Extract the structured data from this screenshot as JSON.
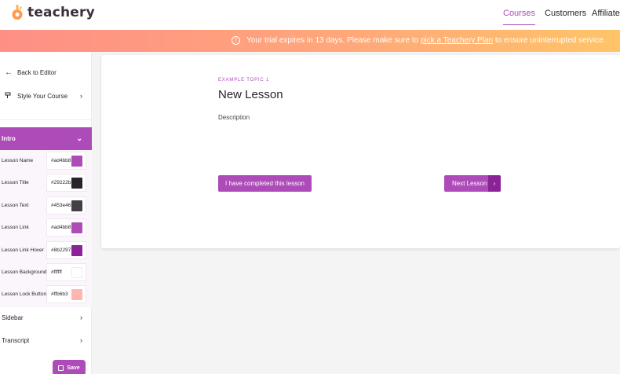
{
  "brand": {
    "name": "teachery",
    "accent": "#ad4bb8"
  },
  "nav": {
    "courses": "Courses",
    "customers": "Customers",
    "affiliates": "Affiliates"
  },
  "banner": {
    "text_before": "Your trial expires in 13 days. Please make sure to",
    "link": "pick a Teachery Plan",
    "text_after": "to ensure uninterrupted service.",
    "icon": "info-icon"
  },
  "sidebar": {
    "back_label": "Back to Editor",
    "style_label": "Style Your Course",
    "intro_label": "Intro",
    "settings": [
      {
        "label": "Lesson Name",
        "hex": "#ad4bb8",
        "color": "#ad4bb8"
      },
      {
        "label": "Lesson Title",
        "hex": "#29222b",
        "color": "#29222b"
      },
      {
        "label": "Lesson Text",
        "hex": "#453e46",
        "color": "#453e46"
      },
      {
        "label": "Lesson Link",
        "hex": "#ad4bb8",
        "color": "#ad4bb8"
      },
      {
        "label": "Lesson Link Hover",
        "hex": "#8b2297",
        "color": "#8b2297"
      },
      {
        "label": "Lesson Background",
        "hex": "#ffffff",
        "color": "#ffffff"
      },
      {
        "label": "Lesson Lock Button",
        "hex": "#ffb6b3",
        "color": "#ffb6b3"
      }
    ],
    "sidebar_label": "Sidebar",
    "transcript_label": "Transcript",
    "save_label": "Save"
  },
  "lesson": {
    "topic": "EXAMPLE TOPIC 1",
    "title": "New Lesson",
    "description": "Description",
    "complete_label": "I have completed this lesson",
    "next_label": "Next Lesson"
  }
}
